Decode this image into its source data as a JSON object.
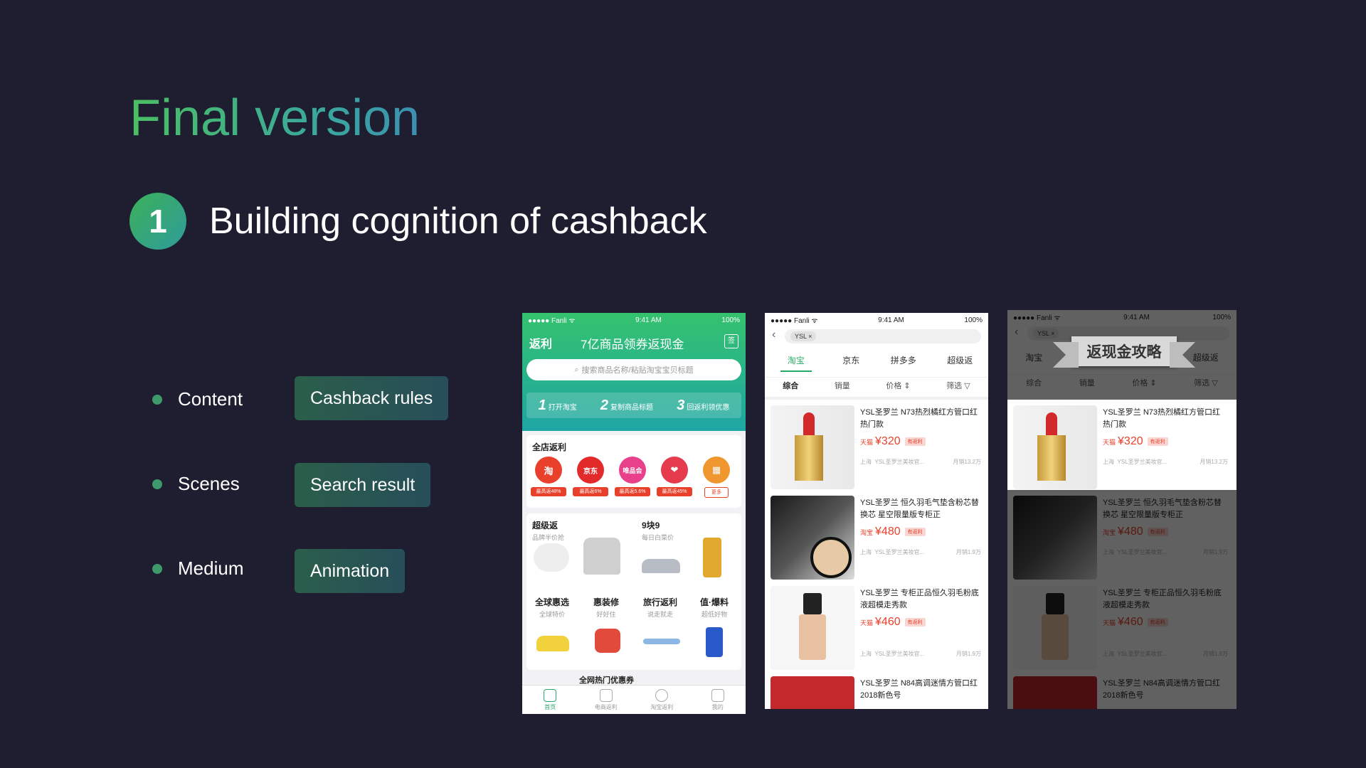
{
  "heading": {
    "title": "Final version",
    "step_number": "1",
    "subtitle": "Building cognition of cashback"
  },
  "bullets": [
    {
      "label": "Content",
      "pill": "Cashback rules"
    },
    {
      "label": "Scenes",
      "pill": "Search result"
    },
    {
      "label": "Medium",
      "pill": "Animation"
    }
  ],
  "phone1": {
    "status": {
      "carrier": "●●●●● Fanli ᯤ",
      "time": "9:41 AM",
      "battery": "100%"
    },
    "brand": "返利",
    "header_title": "7亿商品领券返现金",
    "sign_label": "签",
    "search_placeholder": "搜索商品名称/粘贴淘宝宝贝标题",
    "steps": [
      {
        "n": "1",
        "text": "打开淘宝"
      },
      {
        "n": "2",
        "text": "复制商品标题"
      },
      {
        "n": "3",
        "text": "回返利领优惠"
      }
    ],
    "store_section_title": "全店返利",
    "stores": [
      {
        "name": "淘",
        "tag": "最高返48%",
        "color": "#e9402b"
      },
      {
        "name": "京东",
        "tag": "最高返6%",
        "color": "#e32a2a"
      },
      {
        "name": "唯品会",
        "tag": "最高返5.6%",
        "color": "#e8408a"
      },
      {
        "name": "❤",
        "tag": "最高返45%",
        "color": "#e63a4e"
      },
      {
        "name": "▦",
        "tag": "更多",
        "color": "#f0962f"
      }
    ],
    "categories": [
      {
        "title": "超级返",
        "sub": "品牌半价抢"
      },
      {
        "title": "9块9",
        "sub": "每日白菜价"
      },
      {
        "title": "全球惠选",
        "sub": "全球特价"
      },
      {
        "title": "惠装修",
        "sub": "好好住"
      },
      {
        "title": "旅行返利",
        "sub": "说走就走"
      },
      {
        "title": "值·爆料",
        "sub": "超低好物"
      }
    ],
    "promo_partial": "全网热门优惠券",
    "tabs": [
      "首页",
      "电商返利",
      "淘宝返利",
      "我的"
    ]
  },
  "phone2": {
    "status": {
      "carrier": "●●●●● Fanli ᯤ",
      "time": "9:41 AM",
      "battery": "100%"
    },
    "search_chip": "YSL ×",
    "channels": [
      "淘宝",
      "京东",
      "拼多多",
      "超级返"
    ],
    "sort": [
      "综合",
      "销量",
      "价格 ⇕",
      "筛选 ▽"
    ],
    "products": [
      {
        "title": "YSL圣罗兰 N73热烈橘红方管口红 热门款",
        "shop": "天猫",
        "price": "¥320",
        "rebate": "有返利",
        "location": "上海",
        "seller": "YSL圣罗兰美妆官...",
        "sales": "月销13.2万"
      },
      {
        "title": "YSL圣罗兰 恒久羽毛气垫含粉芯替换芯 星空限量版专柜正",
        "shop": "淘宝",
        "price": "¥480",
        "rebate": "有返利",
        "location": "上海",
        "seller": "YSL圣罗兰美妆官...",
        "sales": "月销1.9万"
      },
      {
        "title": "YSL圣罗兰 专柜正品恒久羽毛粉底液超模走秀款",
        "shop": "天猫",
        "price": "¥460",
        "rebate": "有返利",
        "location": "上海",
        "seller": "YSL圣罗兰美妆官...",
        "sales": "月销1.9万"
      },
      {
        "title": "YSL圣罗兰 N84高调迷情方管口红 2018新色号",
        "shop": "",
        "price": "",
        "rebate": "",
        "location": "",
        "seller": "",
        "sales": ""
      }
    ]
  },
  "phone3": {
    "ribbon_text": "返现金攻略"
  }
}
